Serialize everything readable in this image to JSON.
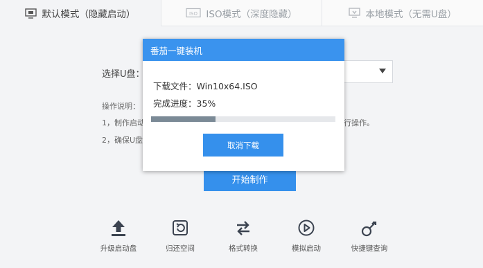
{
  "tabs": [
    {
      "label": "默认模式（隐藏启动）",
      "icon": "monitor-icon",
      "active": true
    },
    {
      "label": "ISO模式（深度隐藏）",
      "icon": "iso-icon",
      "active": false
    },
    {
      "label": "本地模式（无需U盘）",
      "icon": "monitor-download-icon",
      "active": false
    }
  ],
  "form": {
    "u_label": "选择U盘："
  },
  "instructions": {
    "title": "操作说明：",
    "line1": "1，制作启动",
    "line1_tail": "行操作。",
    "line2": "2，确保U盘"
  },
  "start_button": "开始制作",
  "tools": [
    {
      "label": "升级启动盘",
      "icon": "upload-arrow-icon"
    },
    {
      "label": "归还空间",
      "icon": "restore-icon"
    },
    {
      "label": "格式转换",
      "icon": "swap-arrows-icon"
    },
    {
      "label": "模拟启动",
      "icon": "play-circle-icon"
    },
    {
      "label": "快捷键查询",
      "icon": "key-icon"
    }
  ],
  "dialog": {
    "title": "番茄一键装机",
    "file_label": "下载文件：",
    "file_name": "Win10x64.ISO",
    "progress_label": "完成进度：",
    "progress_text": "35%",
    "progress_fraction": 0.35,
    "cancel_button": "取消下载"
  },
  "colors": {
    "accent": "#3590ec",
    "progress": "#7b8a96"
  }
}
